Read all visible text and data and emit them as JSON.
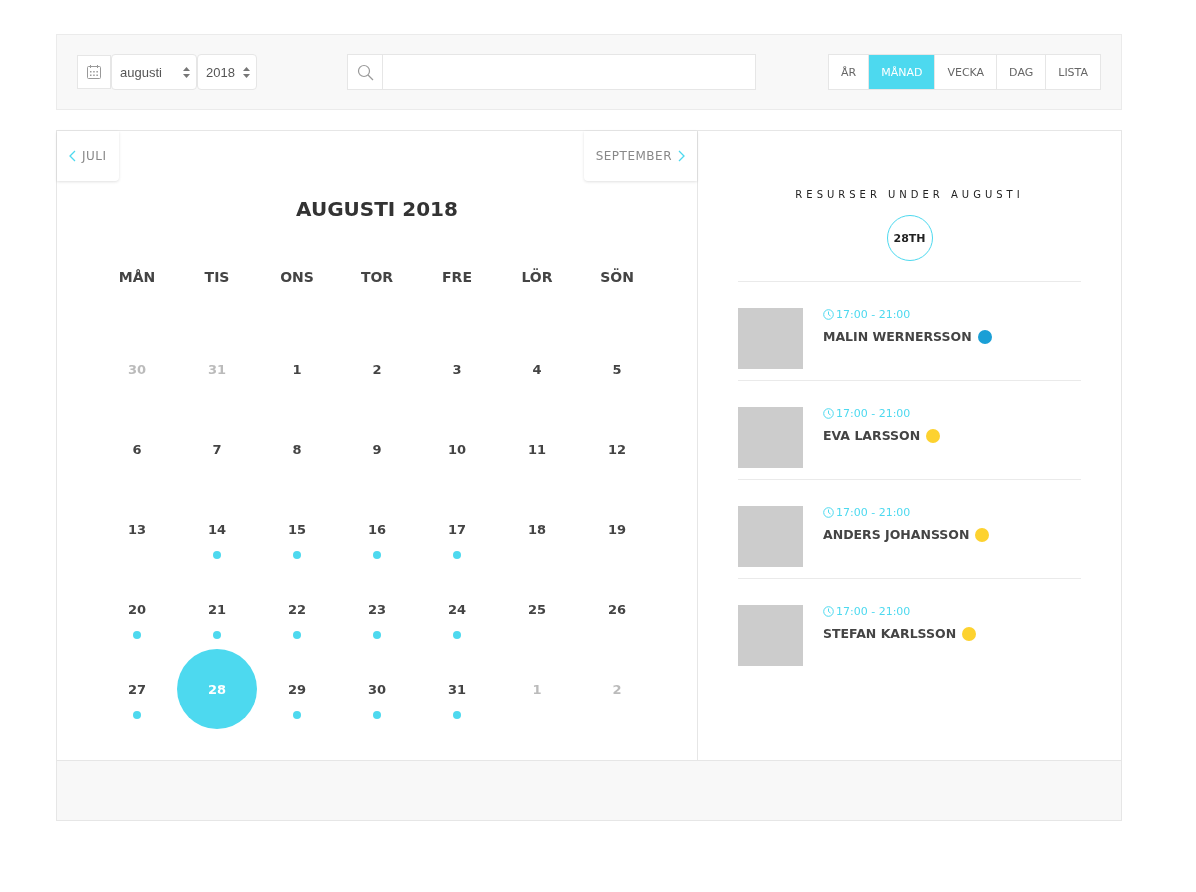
{
  "toolbar": {
    "month_select": {
      "value": "augusti"
    },
    "year_select": {
      "value": "2018"
    },
    "views": [
      {
        "label": "ÅR",
        "selected": false
      },
      {
        "label": "MÅNAD",
        "selected": true
      },
      {
        "label": "VECKA",
        "selected": false
      },
      {
        "label": "DAG",
        "selected": false
      },
      {
        "label": "LISTA",
        "selected": false
      }
    ]
  },
  "calendar": {
    "prev": "JULI",
    "next": "SEPTEMBER",
    "title": "AUGUSTI 2018",
    "weekdays": [
      "MÅN",
      "TIS",
      "ONS",
      "TOR",
      "FRE",
      "LÖR",
      "SÖN"
    ],
    "days": [
      {
        "label": "30",
        "muted": true,
        "event": false,
        "selected": false
      },
      {
        "label": "31",
        "muted": true,
        "event": false,
        "selected": false
      },
      {
        "label": "1",
        "muted": false,
        "event": false,
        "selected": false
      },
      {
        "label": "2",
        "muted": false,
        "event": false,
        "selected": false
      },
      {
        "label": "3",
        "muted": false,
        "event": false,
        "selected": false
      },
      {
        "label": "4",
        "muted": false,
        "event": false,
        "selected": false
      },
      {
        "label": "5",
        "muted": false,
        "event": false,
        "selected": false
      },
      {
        "label": "6",
        "muted": false,
        "event": false,
        "selected": false
      },
      {
        "label": "7",
        "muted": false,
        "event": false,
        "selected": false
      },
      {
        "label": "8",
        "muted": false,
        "event": false,
        "selected": false
      },
      {
        "label": "9",
        "muted": false,
        "event": false,
        "selected": false
      },
      {
        "label": "10",
        "muted": false,
        "event": false,
        "selected": false
      },
      {
        "label": "11",
        "muted": false,
        "event": false,
        "selected": false
      },
      {
        "label": "12",
        "muted": false,
        "event": false,
        "selected": false
      },
      {
        "label": "13",
        "muted": false,
        "event": false,
        "selected": false
      },
      {
        "label": "14",
        "muted": false,
        "event": true,
        "selected": false
      },
      {
        "label": "15",
        "muted": false,
        "event": true,
        "selected": false
      },
      {
        "label": "16",
        "muted": false,
        "event": true,
        "selected": false
      },
      {
        "label": "17",
        "muted": false,
        "event": true,
        "selected": false
      },
      {
        "label": "18",
        "muted": false,
        "event": false,
        "selected": false
      },
      {
        "label": "19",
        "muted": false,
        "event": false,
        "selected": false
      },
      {
        "label": "20",
        "muted": false,
        "event": true,
        "selected": false
      },
      {
        "label": "21",
        "muted": false,
        "event": true,
        "selected": false
      },
      {
        "label": "22",
        "muted": false,
        "event": true,
        "selected": false
      },
      {
        "label": "23",
        "muted": false,
        "event": true,
        "selected": false
      },
      {
        "label": "24",
        "muted": false,
        "event": true,
        "selected": false
      },
      {
        "label": "25",
        "muted": false,
        "event": false,
        "selected": false
      },
      {
        "label": "26",
        "muted": false,
        "event": false,
        "selected": false
      },
      {
        "label": "27",
        "muted": false,
        "event": true,
        "selected": false
      },
      {
        "label": "28",
        "muted": false,
        "event": false,
        "selected": true
      },
      {
        "label": "29",
        "muted": false,
        "event": true,
        "selected": false
      },
      {
        "label": "30",
        "muted": false,
        "event": true,
        "selected": false
      },
      {
        "label": "31",
        "muted": false,
        "event": true,
        "selected": false
      },
      {
        "label": "1",
        "muted": true,
        "event": false,
        "selected": false
      },
      {
        "label": "2",
        "muted": true,
        "event": false,
        "selected": false
      }
    ]
  },
  "resources": {
    "heading": "RESURSER UNDER AUGUSTI",
    "date": "28TH",
    "items": [
      {
        "time": "17:00 - 21:00",
        "name": "MALIN WERNERSSON",
        "color": "#1a9fd6"
      },
      {
        "time": "17:00 - 21:00",
        "name": "EVA LARSSON",
        "color": "#fdd22f"
      },
      {
        "time": "17:00 - 21:00",
        "name": "ANDERS JOHANSSON",
        "color": "#fdd22f"
      },
      {
        "time": "17:00 - 21:00",
        "name": "STEFAN KARLSSON",
        "color": "#fdd22f"
      }
    ]
  }
}
